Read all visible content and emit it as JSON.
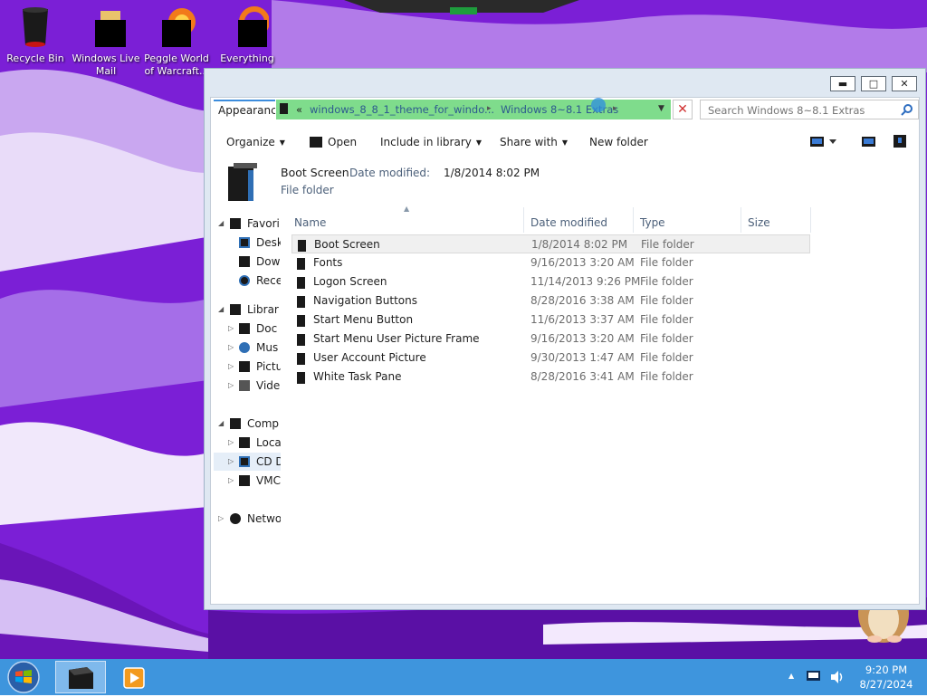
{
  "desktop": {
    "icons": [
      {
        "label": "Recycle Bin",
        "icon": "recycle-bin-icon"
      },
      {
        "label": "Windows Live Mail",
        "icon": "mail-icon"
      },
      {
        "label": "Peggle World of Warcraft...",
        "icon": "game-icon"
      },
      {
        "label": "Everything",
        "icon": "search-app-icon"
      }
    ]
  },
  "window": {
    "controls": {
      "minimize": "▬",
      "maximize": "□",
      "close": "✕"
    },
    "tab_label": "Appearance",
    "address": {
      "overflow": "«",
      "crumbs": [
        "windows_8_8_1_theme_for_windo...",
        "Windows 8~8.1 Extras"
      ],
      "separator": "▸"
    },
    "search_placeholder": "Search Windows 8~8.1 Extras",
    "toolbar": {
      "organize": "Organize",
      "open": "Open",
      "include_in_library": "Include in library",
      "share_with": "Share with",
      "new_folder": "New folder"
    },
    "details": {
      "name": "Boot Screen",
      "date_label": "Date modified:",
      "date_value": "1/8/2014 8:02 PM",
      "type": "File folder"
    },
    "nav": {
      "favorites": "Favori",
      "desktop": "Desk",
      "downloads": "Dow",
      "recent": "Rece",
      "libraries": "Librar",
      "documents": "Doc",
      "music": "Mus",
      "pictures": "Pictu",
      "videos": "Vide",
      "computer": "Comp",
      "local": "Loca",
      "cd": "CD D",
      "vmc": "VMC",
      "network": "Netwo"
    },
    "columns": {
      "name": "Name",
      "date": "Date modified",
      "type": "Type",
      "size": "Size"
    },
    "files": [
      {
        "name": "Boot Screen",
        "date": "1/8/2014 8:02 PM",
        "type": "File folder"
      },
      {
        "name": "Fonts",
        "date": "9/16/2013 3:20 AM",
        "type": "File folder"
      },
      {
        "name": "Logon Screen",
        "date": "11/14/2013 9:26 PM",
        "type": "File folder"
      },
      {
        "name": "Navigation Buttons",
        "date": "8/28/2016 3:38 AM",
        "type": "File folder"
      },
      {
        "name": "Start Menu Button",
        "date": "11/6/2013 3:37 AM",
        "type": "File folder"
      },
      {
        "name": "Start Menu User Picture Frame",
        "date": "9/16/2013 3:20 AM",
        "type": "File folder"
      },
      {
        "name": "User Account Picture",
        "date": "9/30/2013 1:47 AM",
        "type": "File folder"
      },
      {
        "name": "White Task Pane",
        "date": "8/28/2016 3:41 AM",
        "type": "File folder"
      }
    ]
  },
  "taskbar": {
    "time": "9:20 PM",
    "date": "8/27/2024",
    "tray_up": "▲"
  },
  "colors": {
    "wallpaper": "#7b1fd6",
    "address_highlight": "#7fdc8c",
    "taskbar": "#3e95dd"
  }
}
